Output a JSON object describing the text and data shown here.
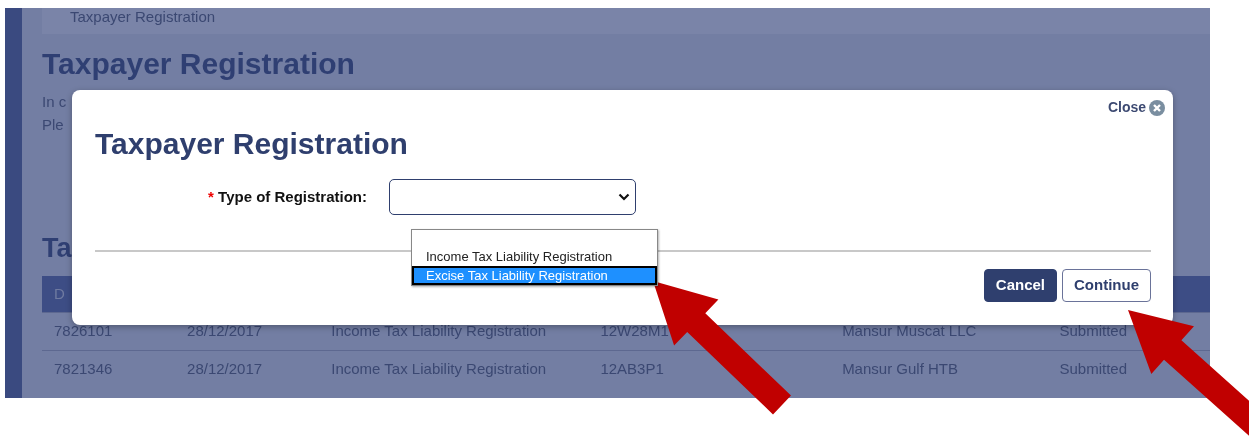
{
  "background": {
    "breadcrumb": "Taxpayer Registration",
    "heading": "Taxpayer Registration",
    "intro_lines": [
      "In c",
      "Ple"
    ],
    "section_heading": "Ta",
    "table": {
      "columns": [
        "D"
      ],
      "rows": [
        [
          "7826101",
          "28/12/2017",
          "Income Tax Liability Registration",
          "12W28M1",
          "Mansur Muscat LLC",
          "Submitted"
        ],
        [
          "7821346",
          "28/12/2017",
          "Income Tax Liability Registration",
          "12AB3P1",
          "Mansur Gulf HTB",
          "Submitted"
        ]
      ]
    }
  },
  "modal": {
    "title": "Taxpayer Registration",
    "close": "Close",
    "field": {
      "required_mark": "*",
      "label": "Type of Registration:",
      "expanded": true,
      "options": [
        {
          "label": "Income Tax Liability Registration",
          "selected": false
        },
        {
          "label": "Excise Tax Liability Registration",
          "selected": true
        }
      ]
    },
    "buttons": [
      {
        "label": "Cancel",
        "kind": "primary"
      },
      {
        "label": "Continue",
        "kind": "outline"
      }
    ]
  }
}
